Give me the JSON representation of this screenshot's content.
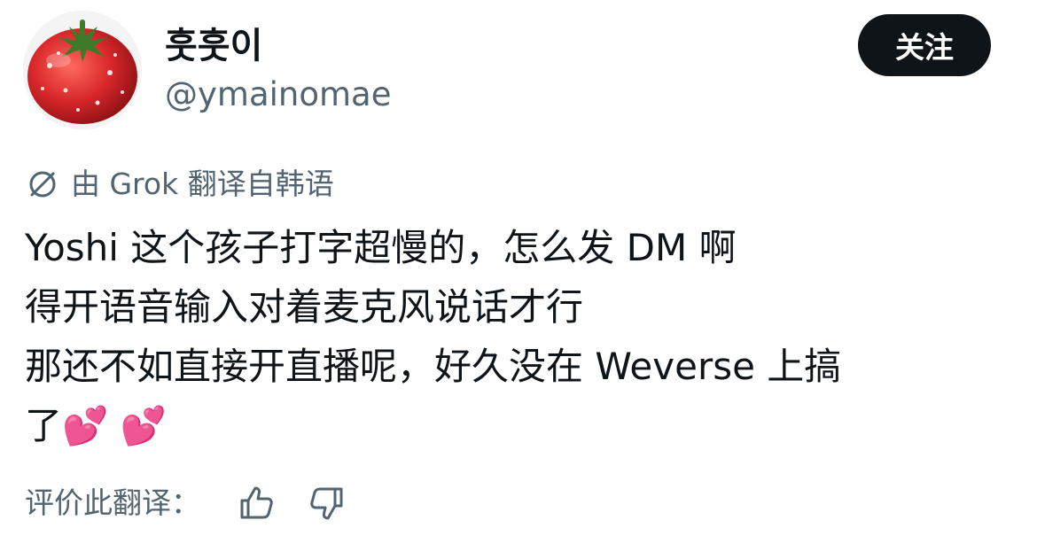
{
  "author": {
    "display_name": "훗훗이",
    "handle": "@ymainomae",
    "avatar_icon": "tomato-avatar"
  },
  "follow_button": {
    "label": "关注"
  },
  "translation_note": {
    "icon": "grok-icon",
    "text": "由 Grok 翻译自韩语"
  },
  "tweet": {
    "lines": [
      "Yoshi 这个孩子打字超慢的，怎么发 DM 啊",
      "得开语音输入对着麦克风说话才行",
      "那还不如直接开直播呢，好久没在 Weverse 上搞",
      "了💕 💕"
    ]
  },
  "rating": {
    "label": "评价此翻译：",
    "thumb_up_icon": "thumbs-up-icon",
    "thumb_down_icon": "thumbs-down-icon"
  },
  "colors": {
    "text_primary": "#0f1419",
    "text_secondary": "#536471",
    "button_bg": "#0f1419",
    "button_text": "#ffffff",
    "tomato_red": "#d8272b"
  }
}
